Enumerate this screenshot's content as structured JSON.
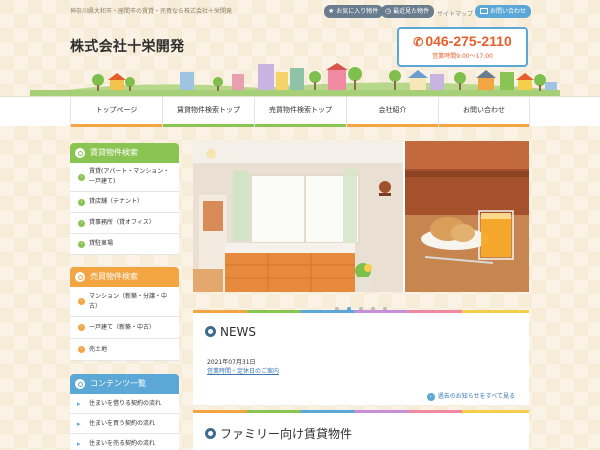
{
  "header": {
    "tagline": "神奈川県大和市・座間市の賃貸・売買なら株式会社十栄開発",
    "favorites_label": "お気に入り物件",
    "recent_label": "最近見た物件",
    "sitemap_label": "サイトマップ",
    "contact_label": "お問い合わせ",
    "company_name": "株式会社十栄開発",
    "phone": "046-275-2110",
    "hours": "営業時間9:00～17:00"
  },
  "nav": {
    "items": [
      {
        "label": "トップページ",
        "color": "#f2a541"
      },
      {
        "label": "賃貸物件検索トップ",
        "color": "#8ac453"
      },
      {
        "label": "売買物件検索トップ",
        "color": "#8ac453"
      },
      {
        "label": "会社紹介",
        "color": "#f2a541"
      },
      {
        "label": "お問い合わせ",
        "color": "#f2a541"
      }
    ]
  },
  "sidebar": {
    "rental": {
      "title": "賃貸物件検索",
      "color": "#8ac453",
      "items": [
        "賃貸(アパート・マンション・一戸建て)",
        "貸店舗（テナント）",
        "貸事務所（貸オフィス）",
        "貸駐車場"
      ]
    },
    "sale": {
      "title": "売買物件検索",
      "color": "#f2a541",
      "items": [
        "マンション（新築・分譲・中古）",
        "一戸建て（新築・中古）",
        "売土地"
      ]
    },
    "contents": {
      "title": "コンテンツ一覧",
      "color": "#5ba7d6",
      "items": [
        "住まいを借りる契約の流れ",
        "住まいを買う契約の流れ",
        "住まいを売る契約の流れ"
      ]
    }
  },
  "slider": {
    "active_index": 1,
    "count": 5
  },
  "news": {
    "title": "NEWS",
    "date": "2021年07月31日",
    "link": "営業時間・定休日のご案内",
    "more_label": "過去のお知らせをすべて見る"
  },
  "family": {
    "title": "ファミリー向け賃貸物件"
  }
}
